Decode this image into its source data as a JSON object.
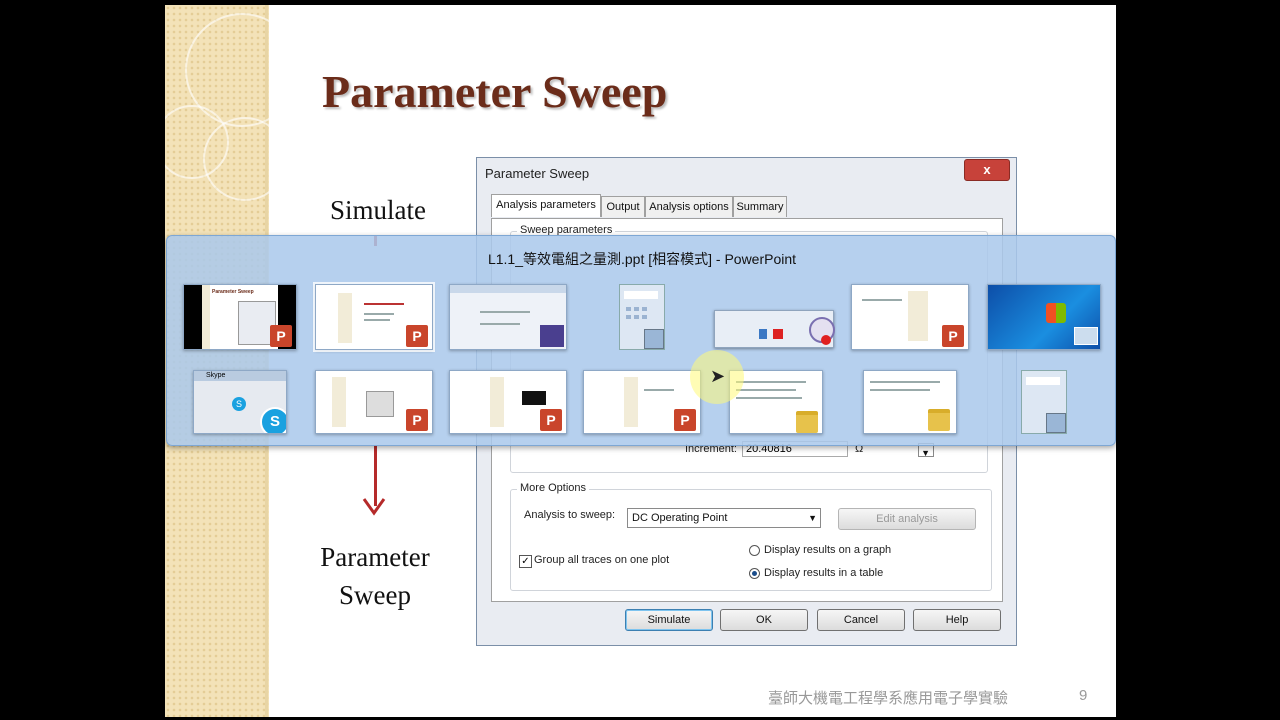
{
  "slide": {
    "title": "Parameter Sweep",
    "label_simulate": "Simulate",
    "label_param_1": "Parameter",
    "label_param_2": "Sweep",
    "footer_text": "臺師大機電工程學系應用電子學實驗",
    "page_number": "9"
  },
  "dialog": {
    "title": "Parameter Sweep",
    "close_glyph": "x",
    "tabs": [
      "Analysis parameters",
      "Output",
      "Analysis options",
      "Summary"
    ],
    "sweep_group_title": "Sweep parameters",
    "increment_label": "Increment:",
    "increment_value": "20.40816",
    "increment_unit": "Ω",
    "more_options_title": "More Options",
    "analysis_to_sweep_label": "Analysis to sweep:",
    "analysis_to_sweep_value": "DC Operating Point",
    "edit_analysis_label": "Edit analysis",
    "group_traces_label": "Group all traces on one plot",
    "group_traces_checked": true,
    "radio_graph_label": "Display results on a graph",
    "radio_table_label": "Display results in a table",
    "radio_selected": "table",
    "buttons": {
      "simulate": "Simulate",
      "ok": "OK",
      "cancel": "Cancel",
      "help": "Help"
    }
  },
  "switcher": {
    "title": "L1.1_等效電組之量測.ppt [相容模式] - PowerPoint",
    "thumb_text_parameter_sweep": "Parameter Sweep",
    "skype_text": "Skype",
    "skype_glyph": "S",
    "ppt_glyph": "P"
  },
  "colors": {
    "title_color": "#6b2c1a",
    "arrow_color": "#b52a2a",
    "switcher_bg": "#aac8eb",
    "ppt_badge": "#c9452b",
    "skype_badge": "#1aa1e0"
  }
}
